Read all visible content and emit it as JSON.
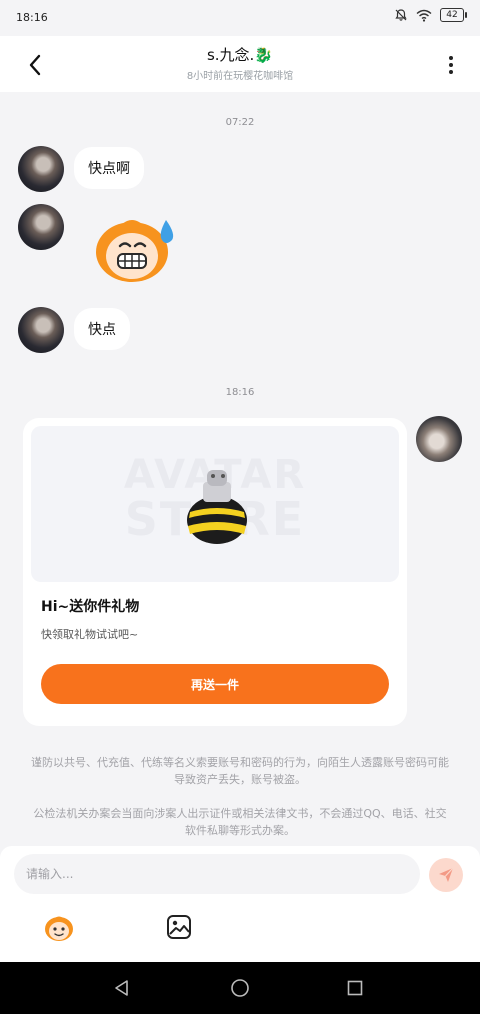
{
  "status_bar": {
    "time": "18:16",
    "battery": "42",
    "icons": [
      "notifications-off-icon",
      "wifi-icon",
      "battery-icon"
    ]
  },
  "header": {
    "title_prefix": "s.九念.",
    "title_emoji": "🐉",
    "subtitle": "8小时前在玩樱花咖啡馆",
    "icons": [
      "back-icon",
      "more-icon"
    ]
  },
  "messages": {
    "timestamp_1": "07:22",
    "text_1": "快点啊",
    "text_2": "快点",
    "timestamp_2": "18:16"
  },
  "gift_card": {
    "watermark_line1": "AVATAR",
    "watermark_line2": "STORE",
    "title": "Hi~送你件礼物",
    "description": "快领取礼物试试吧~",
    "button": "再送一件"
  },
  "notice": {
    "paragraph_1": "谨防以共号、代充值、代练等名义索要账号和密码的行为，向陌生人透露账号密码可能导致资产丢失，账号被盗。",
    "paragraph_2": "公检法机关办案会当面向涉案人出示证件或相关法律文书，不会通过QQ、电话、社交软件私聊等形式办案。"
  },
  "composer": {
    "placeholder": "请输入...",
    "icons": [
      "send-icon",
      "emoji-sticker-icon",
      "image-icon"
    ]
  },
  "colors": {
    "accent": "#f8721c",
    "background": "#f4f4f6",
    "send_disabled": "#fcd9cd"
  }
}
